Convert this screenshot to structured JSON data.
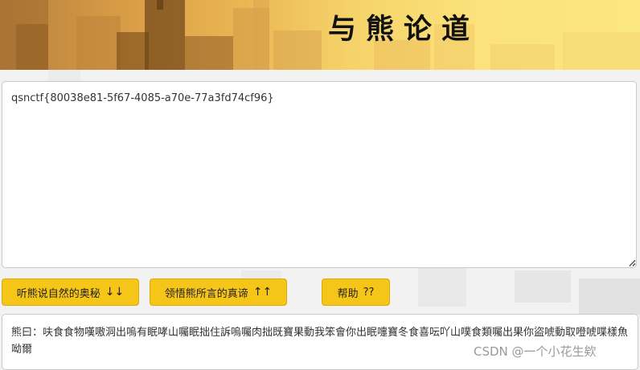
{
  "header": {
    "title": "与熊论道"
  },
  "input": {
    "value": "qsnctf{80038e81-5f67-4085-a70e-77a3fd74cf96}"
  },
  "buttons": {
    "encode_label": "听熊说自然的奥秘",
    "encode_arrow": "↓↓",
    "decode_label": "领悟熊所言的真谛",
    "decode_arrow": "↑↑",
    "help_label": "帮助",
    "help_suffix": "??"
  },
  "output": {
    "text": "熊曰：呋食食物嘆嗷洞出嗚有眠哮山囑眠拙住訴嗚囑肉拙既寶果動我笨會你出眠嚏寶冬食喜呍吖山噗食類囑出果你盜唬動取噔唬喋樣魚呦爾"
  },
  "watermark": {
    "text": "CSDN @一个小花生欸"
  }
}
